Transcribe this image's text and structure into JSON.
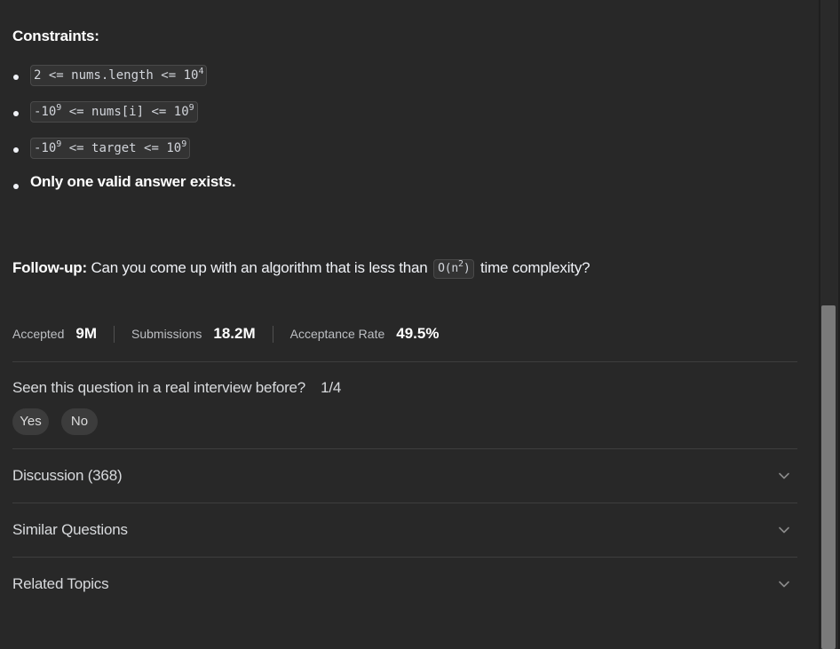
{
  "constraints": {
    "heading": "Constraints:",
    "items": [
      {
        "base": "2 <= nums.length <= 10",
        "sup": "4"
      },
      {
        "pre": "-10",
        "pre_sup": "9",
        "mid": " <= nums[i] <= 10",
        "sup": "9"
      },
      {
        "pre": "-10",
        "pre_sup": "9",
        "mid": " <= target <= 10",
        "sup": "9"
      }
    ],
    "note": "Only one valid answer exists."
  },
  "followup": {
    "label": "Follow-up:",
    "text_before": " Can you come up with an algorithm that is less than ",
    "code_base": "O(n",
    "code_sup": "2",
    "code_end": ")",
    "text_after": " time complexity?"
  },
  "stats": {
    "accepted_label": "Accepted",
    "accepted_value": "9M",
    "submissions_label": "Submissions",
    "submissions_value": "18.2M",
    "rate_label": "Acceptance Rate",
    "rate_value": "49.5%"
  },
  "seen": {
    "question": "Seen this question in a real interview before?",
    "count": "1/4",
    "yes_label": "Yes",
    "no_label": "No"
  },
  "sections": [
    {
      "title": "Discussion (368)",
      "icon": "chevron-down-icon"
    },
    {
      "title": "Similar Questions",
      "icon": "chevron-down-icon"
    },
    {
      "title": "Related Topics",
      "icon": "chevron-down-icon"
    }
  ],
  "colors": {
    "background": "#282828",
    "text": "#eff1f6",
    "code_bg": "#333333",
    "pill_bg": "#3c3c3c",
    "scroll_thumb": "#7a7a7a"
  }
}
